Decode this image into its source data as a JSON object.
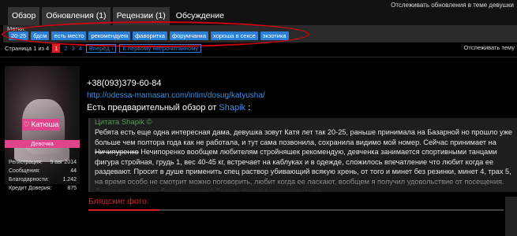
{
  "header": {
    "track_top": "Отслеживать обновления в теме девушки",
    "tabs": [
      {
        "label": "Обзор"
      },
      {
        "label": "Обновления (1)"
      },
      {
        "label": "Рецензии (1)"
      },
      {
        "label": "Обсуждение"
      }
    ]
  },
  "tags": {
    "label": "Метки:",
    "items": [
      "20-25",
      "бдсм",
      "есть место",
      "рекомендуем",
      "фаворитка",
      "форумчанка",
      "хороша в сексе",
      "экзотика"
    ]
  },
  "pagination": {
    "info": "Страница 1 из 4",
    "current": "1",
    "pages": [
      "2",
      "3",
      "4"
    ],
    "next": "Вперёд ›",
    "first_unread": "К первому непрочитанному",
    "track": "Отслеживать тему"
  },
  "profile": {
    "name": "Катюша",
    "role": "Девочка",
    "stats": [
      {
        "label": "Регистрация:",
        "value": "5 авг 2014"
      },
      {
        "label": "Сообщения:",
        "value": "44"
      },
      {
        "label": "Благодарности:",
        "value": "1.242"
      },
      {
        "label": "Кредит Доверия:",
        "value": "875"
      }
    ]
  },
  "post": {
    "phone": "+38(093)379-60-84",
    "link": "http://odessa-mamasan.com/intim/dosug/katyusha/",
    "preview_prefix": "Есть предварительный обзор от ",
    "preview_author": "Shapik",
    "preview_suffix": " :",
    "quote_head": "Цитата Shapik ©",
    "quote_part1": "Ребята есть еще одна интересная дама, девушка зовут Катя лет так 20-25, раньше принимала на Базарной но прошло уже больше чем полтора года как не работала, и тут сама позвонила, сохранила видимо мой номер. Сейчас принимает на ",
    "quote_strike": "Ничипуренко",
    "quote_part2": " Нечипоренко вообщем любителям стройняшек рекомендую, девченка занимается спортивными танцами фигура стройная, грудь 1, вес 40-45 кг, встречает на каблуках и в одежде, сложилось впечатление что любит когда ее раздевают. Просит в душе применить спец раствор убивающий всякую хрень, от того и минет без резинки, минет 4, трах 5, на время особо не смотрит можно поговорить, любит когда ее ласкают, вообщем я получил удовольствие от посещения. Лично сам изредка буду посещать! Да есть минус в квартире у нее",
    "photos_label": "Блядские фото:"
  },
  "colors": {
    "accent_red": "#e31c25",
    "tag_blue": "#2b7fd6",
    "pink": "#e0448a",
    "link_blue": "#3b8fe6"
  }
}
